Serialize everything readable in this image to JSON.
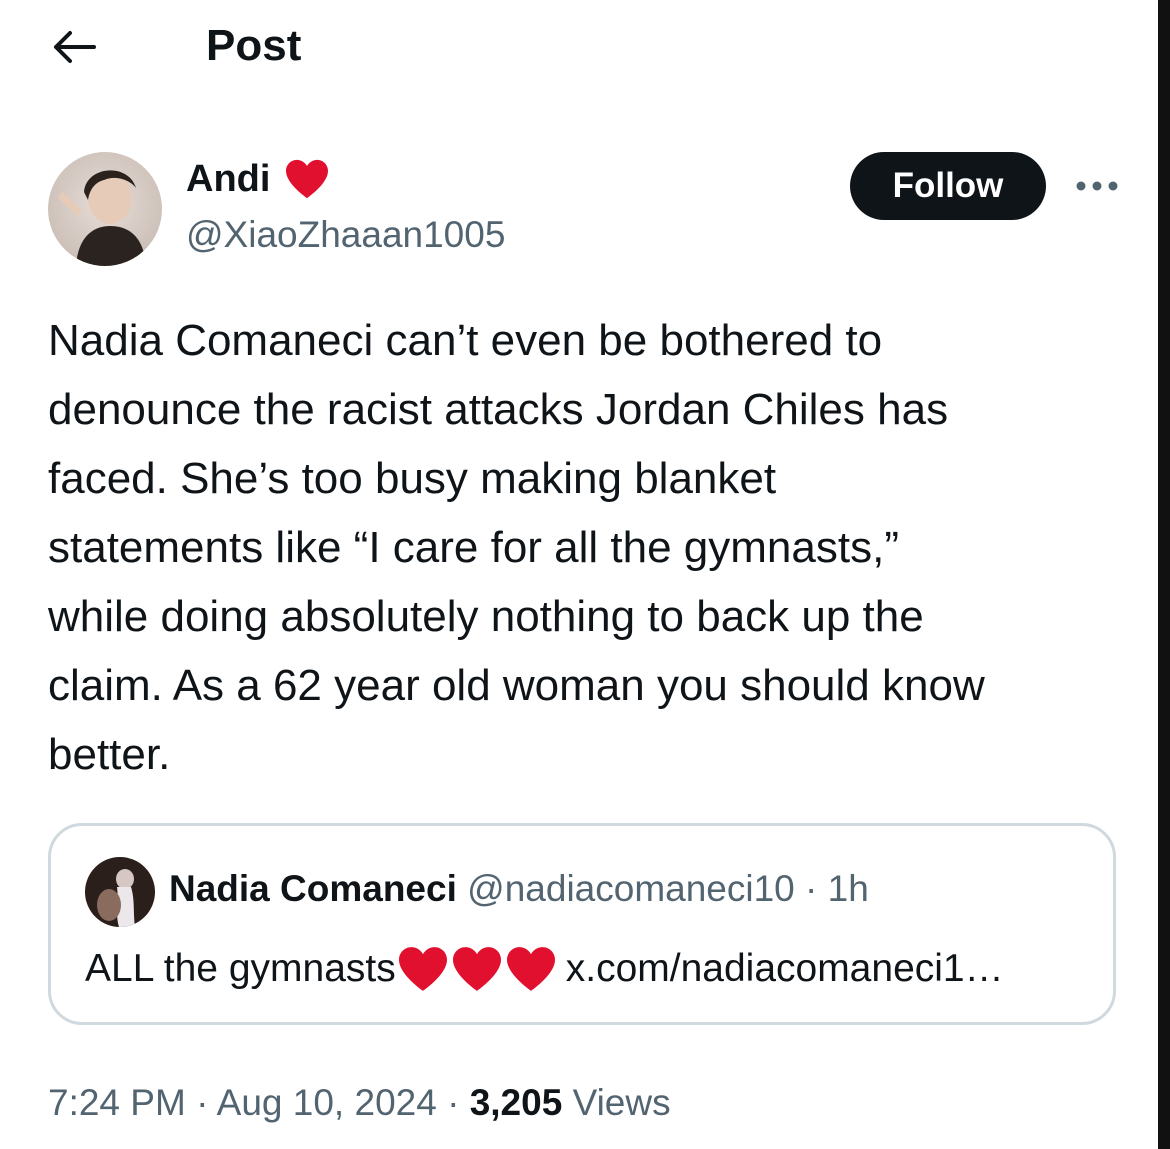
{
  "header": {
    "title": "Post",
    "back_icon": "arrow-left-icon"
  },
  "author": {
    "display_name": "Andi",
    "name_emoji": "heart-icon",
    "handle": "@XiaoZhaaan1005",
    "follow_label": "Follow",
    "more_icon": "more-horizontal-icon"
  },
  "post": {
    "text": "Nadia Comaneci can’t even be bothered to\ndenounce the racist attacks Jordan Chiles has\nfaced. She’s too busy making blanket\nstatements like “I care for all the gymnasts,”\nwhile doing absolutely nothing to back up the\nclaim. As a 62 year old woman you should know\nbetter."
  },
  "quote": {
    "name": "Nadia Comaneci",
    "handle": "@nadiacomaneci10",
    "separator": "·",
    "time": "1h",
    "text": "ALL the gymnasts",
    "link": "x.com/nadiacomaneci1…"
  },
  "meta": {
    "time": "7:24 PM",
    "separator": "·",
    "date": "Aug 10, 2024",
    "views_count": "3,205",
    "views_label": "Views"
  },
  "colors": {
    "text": "#0f1419",
    "secondary": "#536471",
    "heart": "#e0102e",
    "border": "#cfd9de",
    "button": "#0f1419"
  }
}
